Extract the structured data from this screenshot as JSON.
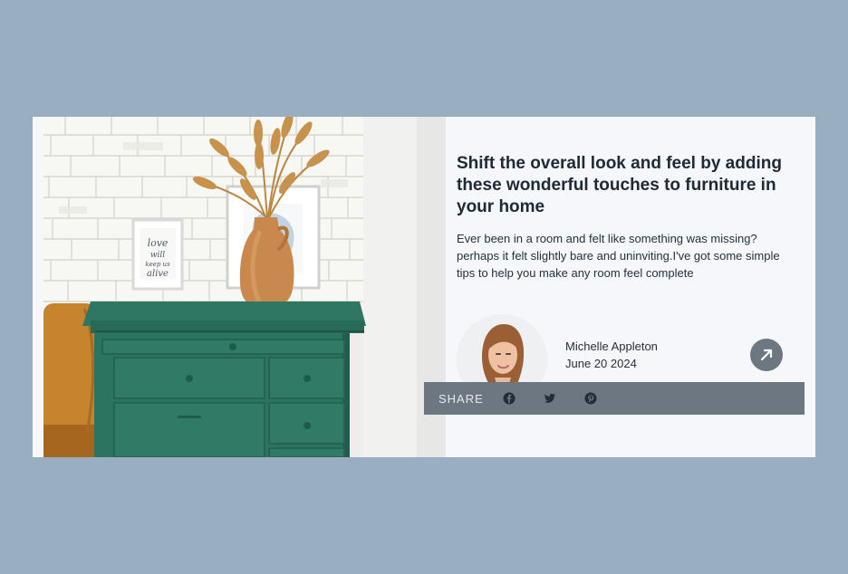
{
  "article": {
    "title": "Shift the overall look and feel by adding these wonderful touches to furniture in your home",
    "excerpt": "Ever been in a room and felt like something was missing? perhaps it felt slightly bare and uninviting.I've got some simple tips to help you make any room feel complete"
  },
  "author": {
    "name": "Michelle Appleton",
    "date": "June 20 2024"
  },
  "share": {
    "label": "SHARE",
    "icons": [
      "facebook-icon",
      "twitter-icon",
      "pinterest-icon"
    ]
  },
  "colors": {
    "page_background": "#9aaec1",
    "card_background": "#f5f7fa",
    "share_bar": "#6c7781",
    "dresser": "#2e7562"
  }
}
